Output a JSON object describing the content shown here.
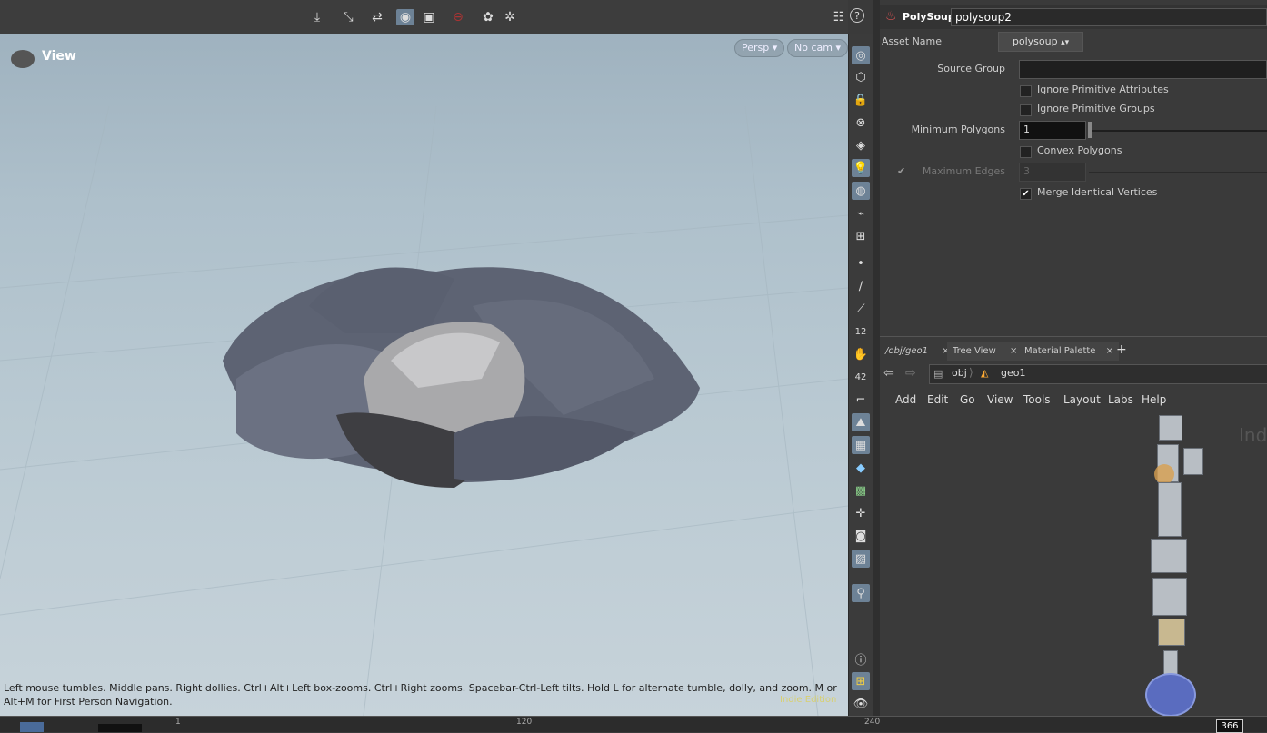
{
  "viewport": {
    "title": "View",
    "persp_label": "Persp",
    "cam_label": "No cam",
    "status_text": "Left mouse tumbles. Middle pans. Right dollies. Ctrl+Alt+Left box-zooms. Ctrl+Right zooms. Spacebar-Ctrl-Left tilts. Hold L for alternate tumble, dolly, and zoom. M or Alt+M for First Person Navigation.",
    "edition": "Indie Edition"
  },
  "param": {
    "node_type": "PolySoup",
    "node_name": "polysoup2",
    "asset_name_label": "Asset Name",
    "asset_name_value": "polysoup",
    "source_group_label": "Source Group",
    "source_group_value": "",
    "ignore_prim_attrs": "Ignore Primitive Attributes",
    "ignore_prim_groups": "Ignore Primitive Groups",
    "min_polygons_label": "Minimum Polygons",
    "min_polygons_value": "1",
    "convex_polygons": "Convex Polygons",
    "max_edges_label": "Maximum Edges",
    "max_edges_value": "3",
    "merge_vertices": "Merge Identical Vertices"
  },
  "network": {
    "tabs": [
      "/obj/geo1",
      "Tree View",
      "Material Palette"
    ],
    "path_obj": "obj",
    "path_geo": "geo1",
    "menu": [
      "Add",
      "Edit",
      "Go",
      "View",
      "Tools",
      "Layout",
      "Labs",
      "Help"
    ],
    "watermark": "Ind"
  },
  "timeline": {
    "tick_1": "1",
    "tick_120": "120",
    "tick_240": "240",
    "frame": "366"
  }
}
